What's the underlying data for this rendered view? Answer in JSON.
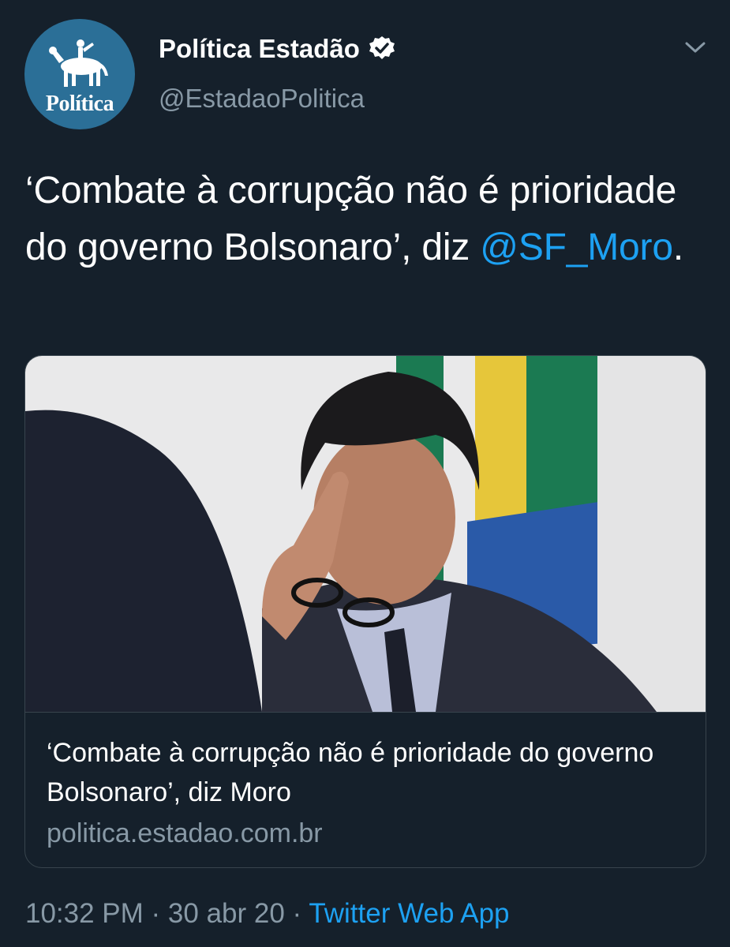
{
  "account": {
    "avatar_label": "Política",
    "display_name": "Política Estadão",
    "handle": "@EstadaoPolitica",
    "verified": true
  },
  "tweet": {
    "text_part1": "‘Combate à corrupção não é prioridade do governo Bolsonaro’, diz ",
    "mention": "@SF_Moro",
    "text_part2": "."
  },
  "card": {
    "image_description_icon": "photo-thumbnail",
    "title": "‘Combate à corrupção não é prioridade do governo Bolsonaro’, diz Moro",
    "domain": "politica.estadao.com.br"
  },
  "meta": {
    "time": "10:32 PM",
    "separator1": " · ",
    "date": "30 abr 20",
    "separator2": " · ",
    "source": "Twitter Web App"
  },
  "colors": {
    "background": "#15202b",
    "accent": "#1da1f2",
    "secondary_text": "#8899a6",
    "border": "#38444d",
    "avatar_bg": "#2b6f97"
  }
}
